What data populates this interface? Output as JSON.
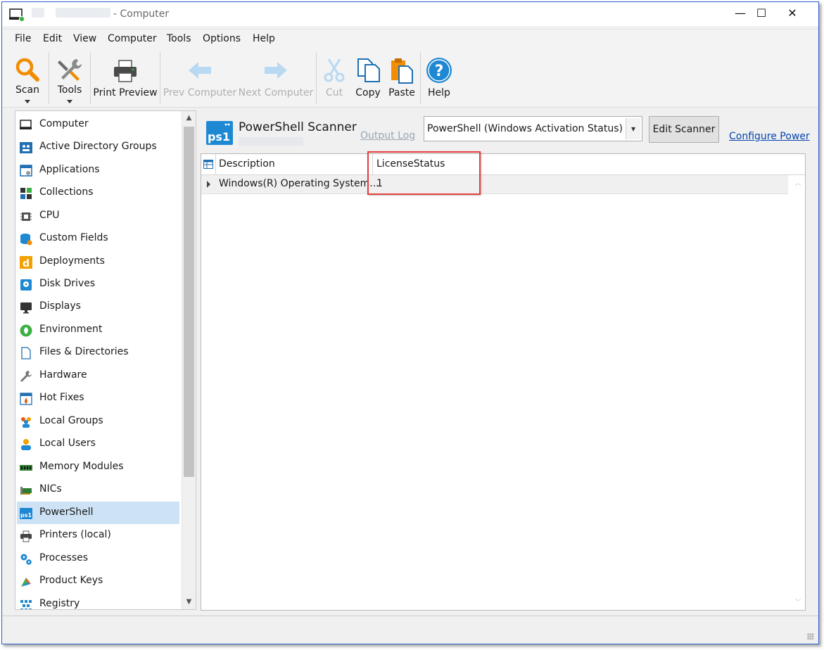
{
  "window": {
    "title": "- Computer"
  },
  "titlebar_buttons": {
    "minimize": "—",
    "maximize": "☐",
    "close": "✕"
  },
  "menu": [
    "File",
    "Edit",
    "View",
    "Computer",
    "Tools",
    "Options",
    "Help"
  ],
  "toolbar": {
    "scan": "Scan",
    "tools": "Tools",
    "print_preview": "Print Preview",
    "prev_computer": "Prev Computer",
    "next_computer": "Next Computer",
    "cut": "Cut",
    "copy": "Copy",
    "paste": "Paste",
    "help": "Help"
  },
  "sidebar": {
    "selected": "PowerShell",
    "items": [
      {
        "label": "Computer",
        "icon": "computer-icon"
      },
      {
        "label": "Active Directory Groups",
        "icon": "ad-groups-icon"
      },
      {
        "label": "Applications",
        "icon": "applications-icon"
      },
      {
        "label": "Collections",
        "icon": "collections-icon"
      },
      {
        "label": "CPU",
        "icon": "cpu-icon"
      },
      {
        "label": "Custom Fields",
        "icon": "custom-fields-icon"
      },
      {
        "label": "Deployments",
        "icon": "deployments-icon"
      },
      {
        "label": "Disk Drives",
        "icon": "disk-drives-icon"
      },
      {
        "label": "Displays",
        "icon": "displays-icon"
      },
      {
        "label": "Environment",
        "icon": "environment-icon"
      },
      {
        "label": "Files & Directories",
        "icon": "files-icon"
      },
      {
        "label": "Hardware",
        "icon": "hardware-icon"
      },
      {
        "label": "Hot Fixes",
        "icon": "hot-fixes-icon"
      },
      {
        "label": "Local Groups",
        "icon": "local-groups-icon"
      },
      {
        "label": "Local Users",
        "icon": "local-users-icon"
      },
      {
        "label": "Memory Modules",
        "icon": "memory-icon"
      },
      {
        "label": "NICs",
        "icon": "nic-icon"
      },
      {
        "label": "PowerShell",
        "icon": "powershell-icon"
      },
      {
        "label": "Printers (local)",
        "icon": "printer-icon"
      },
      {
        "label": "Processes",
        "icon": "processes-icon"
      },
      {
        "label": "Product Keys",
        "icon": "product-keys-icon"
      },
      {
        "label": "Registry",
        "icon": "registry-icon"
      }
    ]
  },
  "scanner": {
    "icon_text": "ps1",
    "title": "PowerShell Scanner",
    "output_log": "Output Log",
    "selected_scanner": "PowerShell (Windows Activation Status)",
    "edit_button": "Edit Scanner",
    "configure_link": "Configure Power"
  },
  "grid": {
    "columns": [
      "Description",
      "LicenseStatus"
    ],
    "rows": [
      [
        "Windows(R) Operating System...",
        "1"
      ]
    ]
  },
  "colors": {
    "accent": "#0078d7",
    "selection": "#cde3f5",
    "highlight_border": "#e53e3e",
    "link": "#0645ad"
  }
}
